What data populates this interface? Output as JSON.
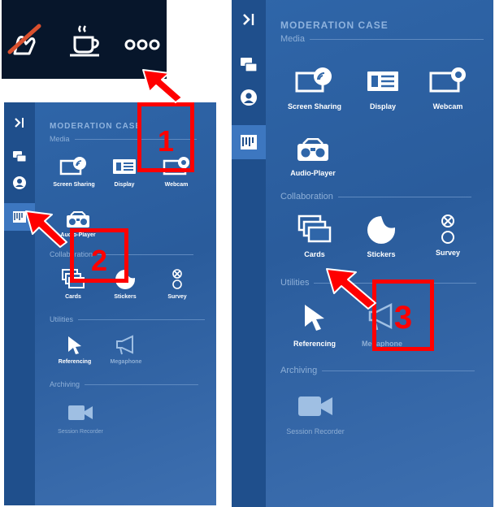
{
  "left_panel": {
    "header": "MODERATION CASE",
    "sections": {
      "media": "Media",
      "collaboration": "Collaboration",
      "utilities": "Utilities",
      "archiving": "Archiving"
    },
    "tools": {
      "screen_sharing": "Screen Sharing",
      "display": "Display",
      "webcam": "Webcam",
      "audio_player": "Audio-Player",
      "cards": "Cards",
      "stickers": "Stickers",
      "survey": "Survey",
      "referencing": "Referencing",
      "megaphone": "Megaphone",
      "session_recorder": "Session Recorder"
    }
  },
  "right_panel": {
    "header": "MODERATION CASE",
    "sections": {
      "media": "Media",
      "collaboration": "Collaboration",
      "utilities": "Utilities",
      "archiving": "Archiving"
    },
    "tools": {
      "screen_sharing": "Screen Sharing",
      "display": "Display",
      "webcam": "Webcam",
      "audio_player": "Audio-Player",
      "cards": "Cards",
      "stickers": "Stickers",
      "survey": "Survey",
      "referencing": "Referencing",
      "megaphone": "Megaphone",
      "session_recorder": "Session Recorder"
    }
  },
  "steps": {
    "step1": "1",
    "step2": "2",
    "step3": "3"
  },
  "colors": {
    "marker": "#ff0000",
    "panel": "#2f66a9",
    "rail": "#1f4f8c",
    "topbar": "#07162b"
  }
}
